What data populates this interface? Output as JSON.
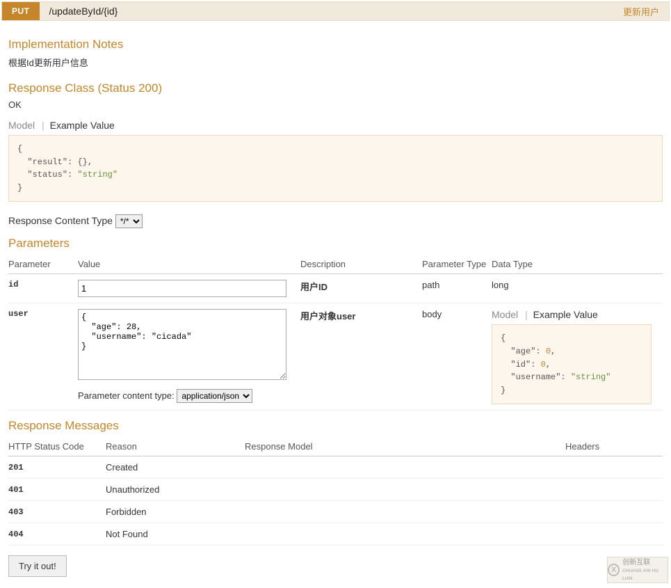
{
  "header": {
    "method": "PUT",
    "path": "/updateById/{id}",
    "summary": "更新用户"
  },
  "impl_notes": {
    "title": "Implementation Notes",
    "text": "根据Id更新用户信息"
  },
  "resp_class": {
    "title": "Response Class (Status 200)",
    "ok": "OK",
    "tabs": {
      "model": "Model",
      "example": "Example Value"
    },
    "example_json": "{\n  \"result\": {},\n  \"status\": \"string\"\n}"
  },
  "resp_content_type": {
    "label": "Response Content Type",
    "value": "*/*"
  },
  "parameters": {
    "title": "Parameters",
    "headers": {
      "parameter": "Parameter",
      "value": "Value",
      "description": "Description",
      "ptype": "Parameter Type",
      "dtype": "Data Type"
    },
    "rows": [
      {
        "name": "id",
        "value": "1",
        "description": "用户ID",
        "ptype": "path",
        "dtype": "long"
      },
      {
        "name": "user",
        "value": "{\n  \"age\": 28,\n  \"username\": \"cicada\"\n}",
        "description": "用户对象user",
        "ptype": "body",
        "dtype_tabs": {
          "model": "Model",
          "example": "Example Value"
        },
        "dtype_example": "{\n  \"age\": 0,\n  \"id\": 0,\n  \"username\": \"string\"\n}"
      }
    ],
    "pct": {
      "label": "Parameter content type:",
      "value": "application/json"
    }
  },
  "resp_messages": {
    "title": "Response Messages",
    "headers": {
      "code": "HTTP Status Code",
      "reason": "Reason",
      "model": "Response Model",
      "headers": "Headers"
    },
    "rows": [
      {
        "code": "201",
        "reason": "Created"
      },
      {
        "code": "401",
        "reason": "Unauthorized"
      },
      {
        "code": "403",
        "reason": "Forbidden"
      },
      {
        "code": "404",
        "reason": "Not Found"
      }
    ]
  },
  "tryout": "Try it out!",
  "watermark": {
    "brand": "创新互联",
    "sub": "CHUANG XIN HU LIAN"
  }
}
